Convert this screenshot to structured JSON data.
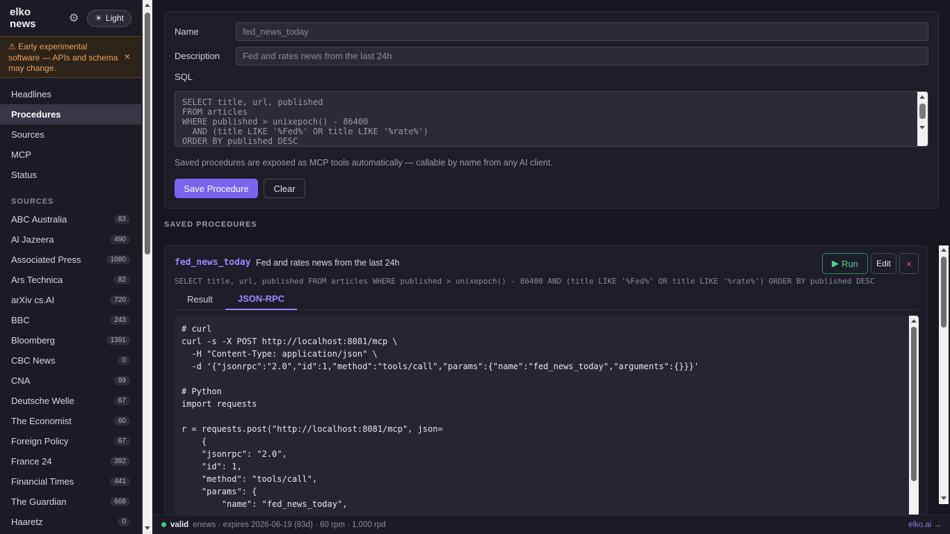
{
  "app": {
    "title": "elko news",
    "theme_label": "Light"
  },
  "banner": {
    "text": "⚠ Early experimental software — APIs and schema may change.",
    "close": "×"
  },
  "nav": [
    {
      "label": "Headlines"
    },
    {
      "label": "Procedures",
      "active": true
    },
    {
      "label": "Sources"
    },
    {
      "label": "MCP"
    },
    {
      "label": "Status"
    }
  ],
  "sources_heading": "SOURCES",
  "sources": [
    {
      "label": "ABC Australia",
      "count": "83"
    },
    {
      "label": "Al Jazeera",
      "count": "490"
    },
    {
      "label": "Associated Press",
      "count": "1080"
    },
    {
      "label": "Ars Technica",
      "count": "82"
    },
    {
      "label": "arXiv cs.AI",
      "count": "720"
    },
    {
      "label": "BBC",
      "count": "243"
    },
    {
      "label": "Bloomberg",
      "count": "1391"
    },
    {
      "label": "CBC News",
      "count": "0"
    },
    {
      "label": "CNA",
      "count": "99"
    },
    {
      "label": "Deutsche Welle",
      "count": "67"
    },
    {
      "label": "The Economist",
      "count": "60"
    },
    {
      "label": "Foreign Policy",
      "count": "67"
    },
    {
      "label": "France 24",
      "count": "392"
    },
    {
      "label": "Financial Times",
      "count": "441"
    },
    {
      "label": "The Guardian",
      "count": "668"
    },
    {
      "label": "Haaretz",
      "count": "0"
    }
  ],
  "form": {
    "name_label": "Name",
    "name_placeholder": "fed_news_today",
    "description_label": "Description",
    "description_placeholder": "Fed and rates news from the last 24h",
    "sql_label": "SQL",
    "sql_placeholder": "SELECT title, url, published\nFROM articles\nWHERE published > unixepoch() - 86400\n  AND (title LIKE '%Fed%' OR title LIKE '%rate%')\nORDER BY published DESC",
    "hint": "Saved procedures are exposed as MCP tools automatically — callable by name from any AI client.",
    "save_label": "Save Procedure",
    "clear_label": "Clear"
  },
  "saved_heading": "SAVED PROCEDURES",
  "procedure": {
    "name": "fed_news_today",
    "description": "Fed and rates news from the last 24h",
    "run_label": "Run",
    "edit_label": "Edit",
    "delete_label": "×",
    "sql": "SELECT title, url, published FROM articles WHERE published > unixepoch() - 86400 AND (title LIKE '%Fed%' OR title LIKE '%rate%') ORDER BY published DESC",
    "tabs": [
      {
        "label": "Result"
      },
      {
        "label": "JSON-RPC",
        "active": true
      }
    ],
    "code": "# curl\ncurl -s -X POST http://localhost:8081/mcp \\\n  -H \"Content-Type: application/json\" \\\n  -d '{\"jsonrpc\":\"2.0\",\"id\":1,\"method\":\"tools/call\",\"params\":{\"name\":\"fed_news_today\",\"arguments\":{}}}'\n\n# Python\nimport requests\n\nr = requests.post(\"http://localhost:8081/mcp\", json=\n    {\n    \"jsonrpc\": \"2.0\",\n    \"id\": 1,\n    \"method\": \"tools/call\",\n    \"params\": {\n        \"name\": \"fed_news_today\","
  },
  "footer": {
    "status": "valid",
    "details": "enews · expires 2026-06-19 (83d) · 60 rpm · 1,000 rpd",
    "link": "elko.ai →"
  }
}
